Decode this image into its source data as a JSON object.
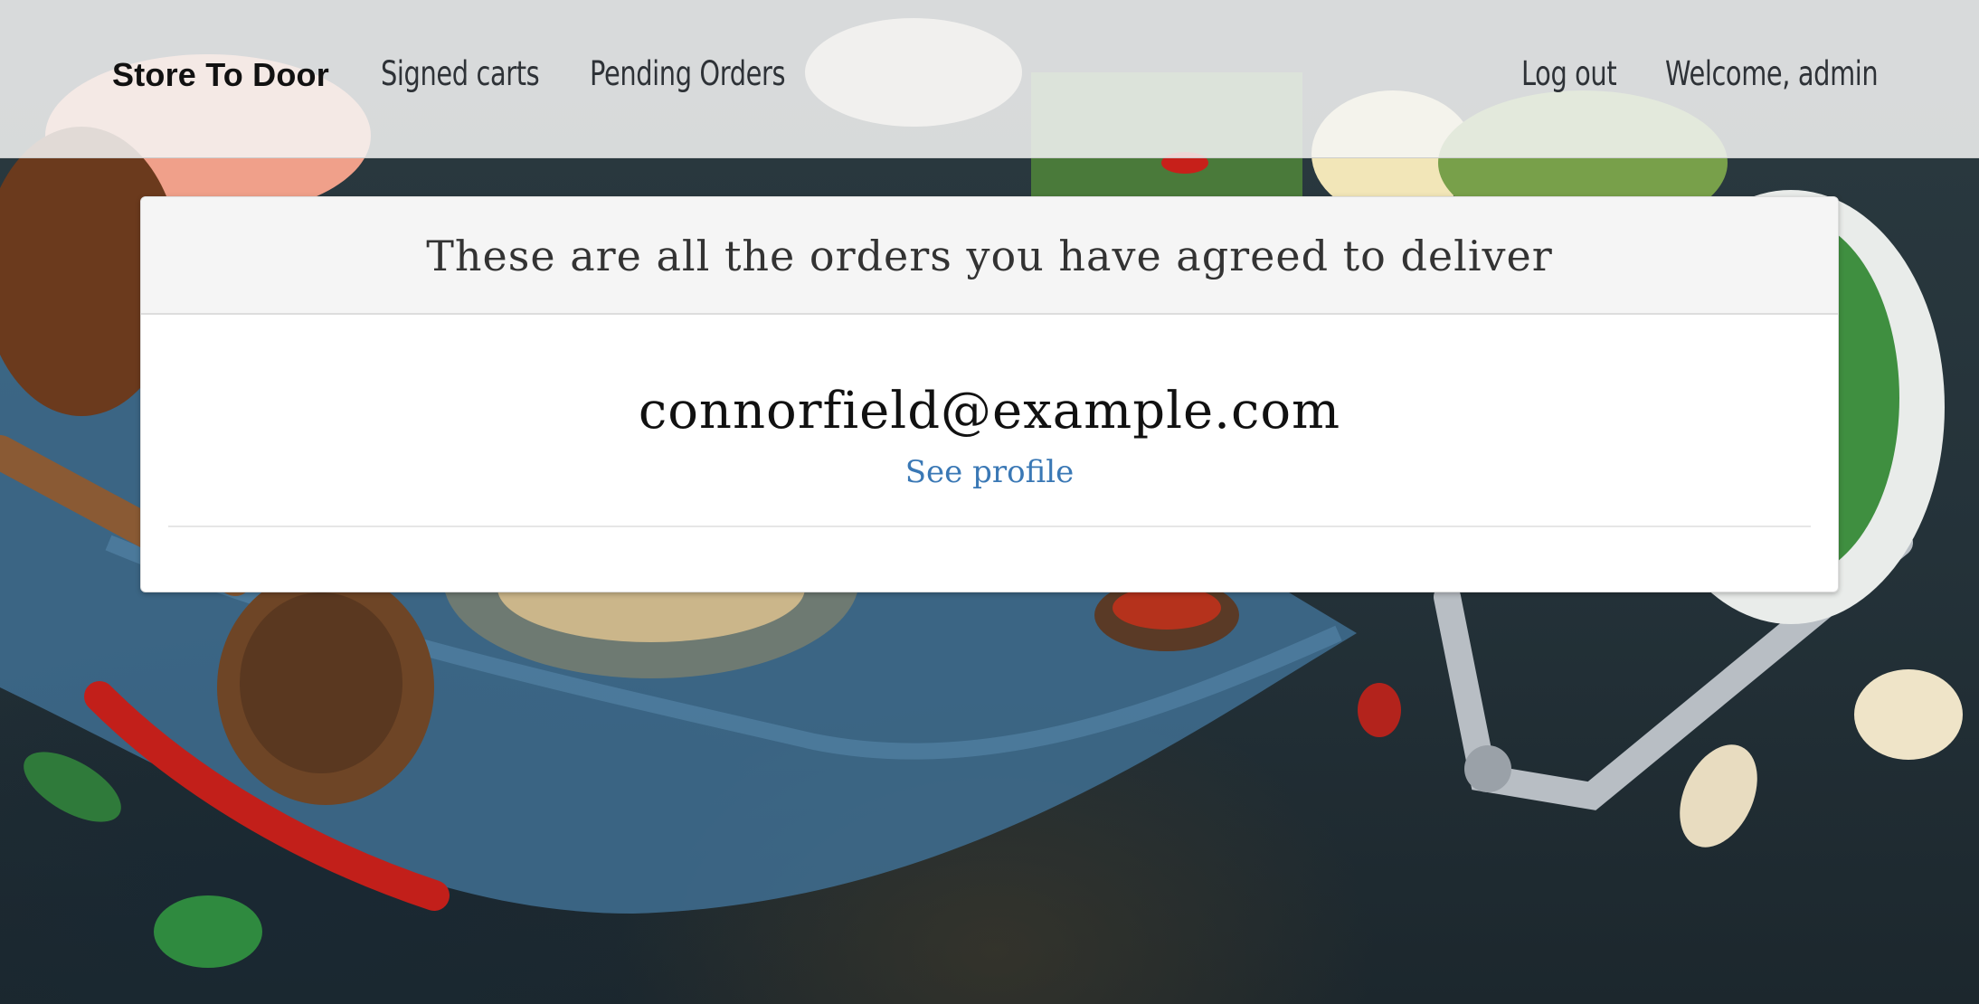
{
  "navbar": {
    "brand": "Store To Door",
    "links": {
      "signed_carts": "Signed carts",
      "pending_orders": "Pending Orders",
      "log_out": "Log out",
      "welcome": "Welcome, admin"
    }
  },
  "panel": {
    "heading": "These are all the orders you have agreed to deliver",
    "orders": [
      {
        "email": "connorfield@example.com",
        "profile_link": "See profile"
      }
    ]
  },
  "colors": {
    "link": "#3a78b5",
    "navbar_bg": "#f4f4f4",
    "panel_heading_bg": "#f5f5f5"
  }
}
